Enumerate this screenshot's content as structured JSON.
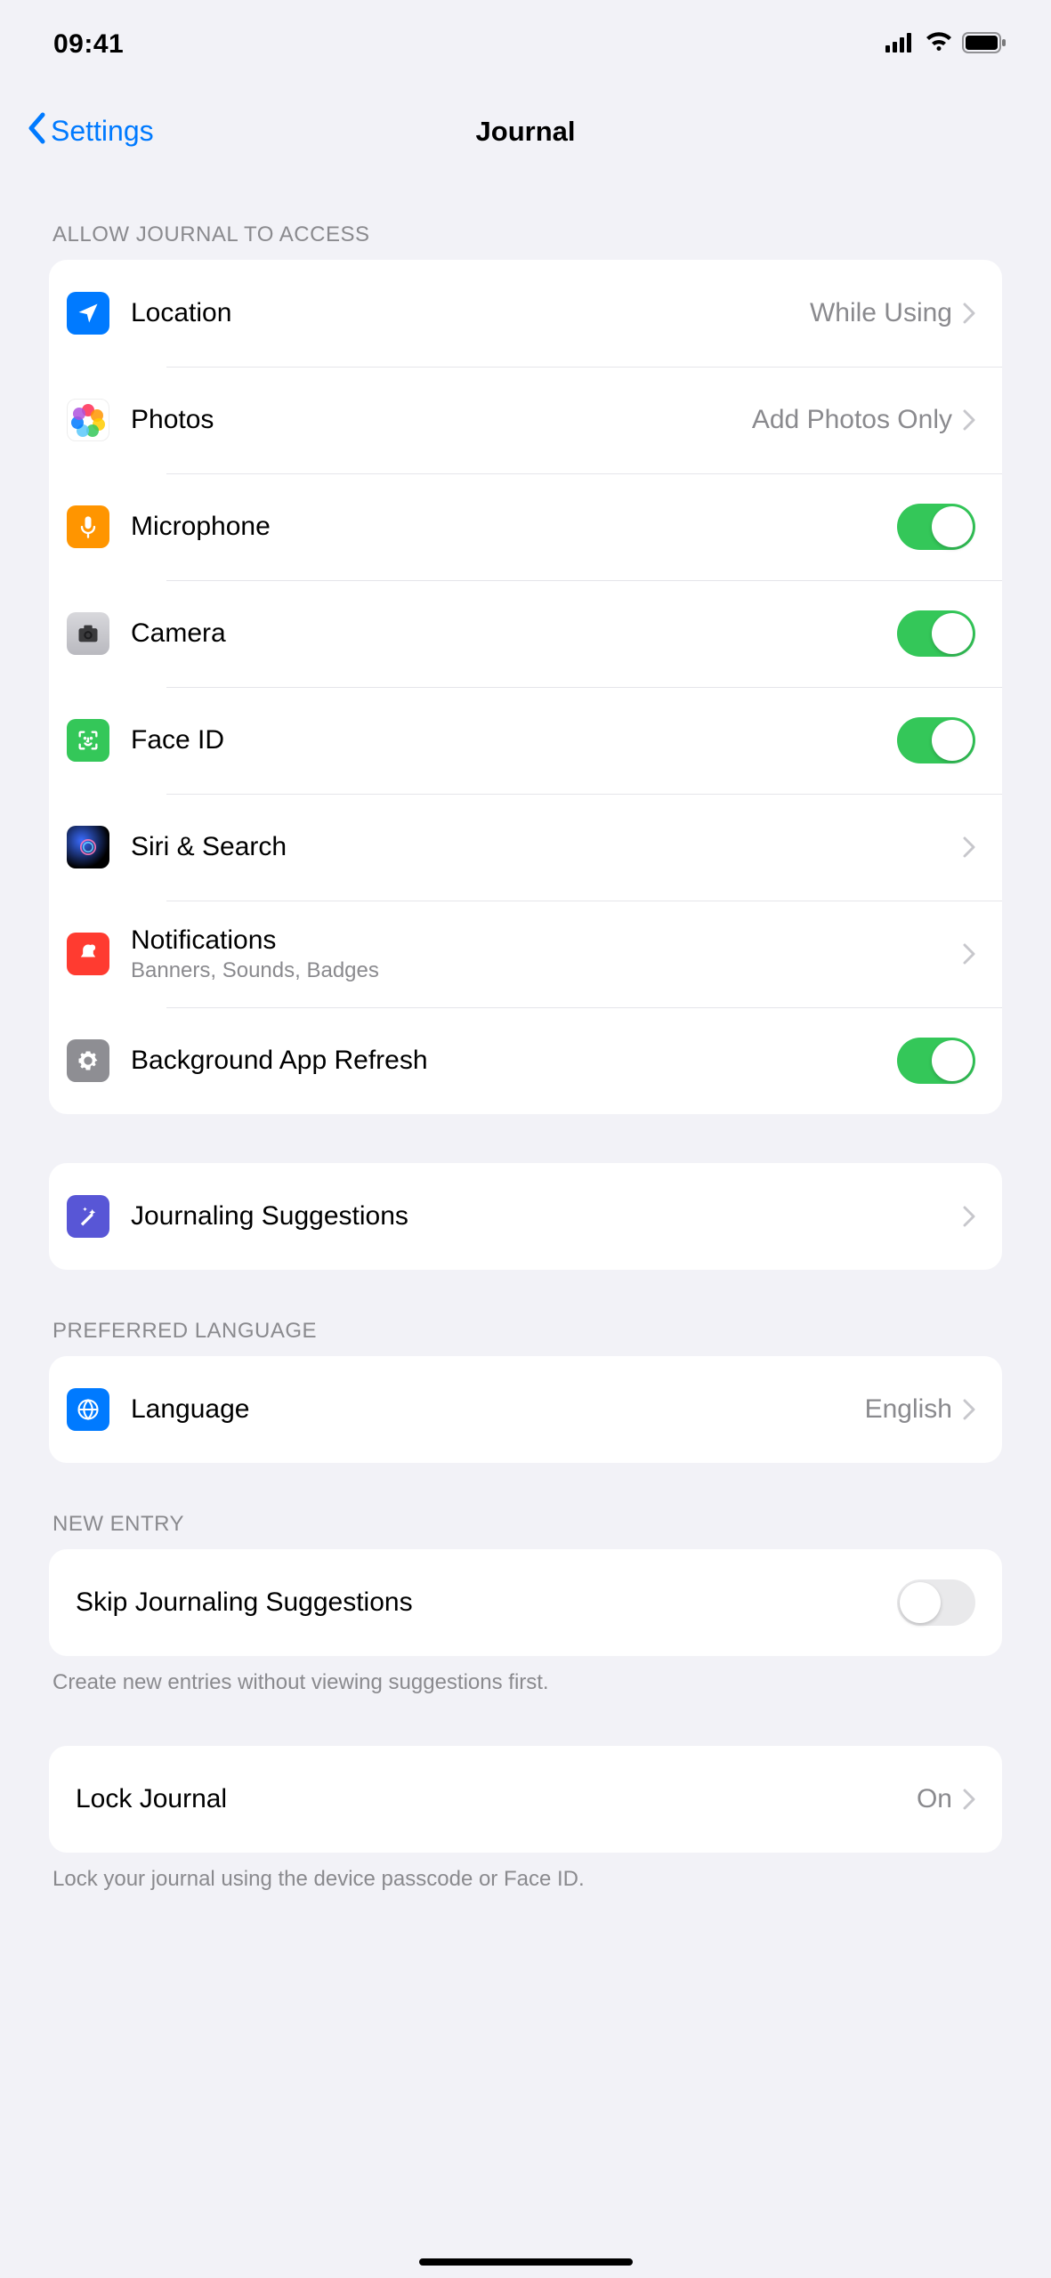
{
  "status": {
    "time": "09:41"
  },
  "nav": {
    "back": "Settings",
    "title": "Journal"
  },
  "section1": {
    "header": "ALLOW JOURNAL TO ACCESS",
    "location": {
      "label": "Location",
      "value": "While Using"
    },
    "photos": {
      "label": "Photos",
      "value": "Add Photos Only"
    },
    "microphone": {
      "label": "Microphone",
      "on": true
    },
    "camera": {
      "label": "Camera",
      "on": true
    },
    "faceid": {
      "label": "Face ID",
      "on": true
    },
    "siri": {
      "label": "Siri & Search"
    },
    "notifications": {
      "label": "Notifications",
      "sub": "Banners, Sounds, Badges"
    },
    "bgrefresh": {
      "label": "Background App Refresh",
      "on": true
    }
  },
  "section2": {
    "suggestions": {
      "label": "Journaling Suggestions"
    }
  },
  "section3": {
    "header": "PREFERRED LANGUAGE",
    "language": {
      "label": "Language",
      "value": "English"
    }
  },
  "section4": {
    "header": "NEW ENTRY",
    "skip": {
      "label": "Skip Journaling Suggestions",
      "on": false
    },
    "footer": "Create new entries without viewing suggestions first."
  },
  "section5": {
    "lock": {
      "label": "Lock Journal",
      "value": "On"
    },
    "footer": "Lock your journal using the device passcode or Face ID."
  }
}
